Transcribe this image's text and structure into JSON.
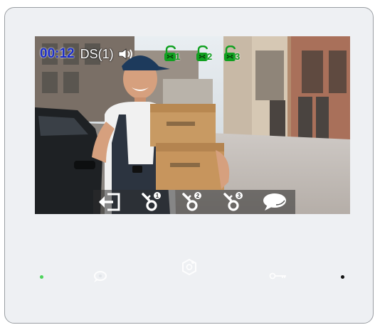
{
  "status": {
    "time": "00:12",
    "source": "DS(1)",
    "locks": [
      {
        "icon": "unlock-1-icon",
        "label": "1"
      },
      {
        "icon": "unlock-2-icon",
        "label": "2"
      },
      {
        "icon": "unlock-3-icon",
        "label": "3"
      }
    ]
  },
  "toolbar": {
    "buttons": [
      {
        "icon": "exit-icon"
      },
      {
        "icon": "key-1-icon",
        "label": "1"
      },
      {
        "icon": "key-2-icon",
        "label": "2"
      },
      {
        "icon": "key-3-icon",
        "label": "3"
      },
      {
        "icon": "talk-icon"
      }
    ]
  },
  "hardware": {
    "buttons": [
      "talk-hw-icon",
      "monitor-hw-icon",
      "key-hw-icon"
    ],
    "leds": [
      "power-led",
      "status-led"
    ]
  },
  "colors": {
    "time": "#1a2cc8",
    "lock_green": "#10a020",
    "power_led": "#4cd35a"
  }
}
